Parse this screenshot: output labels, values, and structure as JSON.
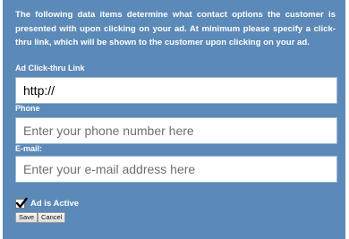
{
  "form": {
    "intro_text": "The following data items determine what contact options the customer is presented with upon clicking on your ad. At minimum please specify a click-thru link, which will be shown to the customer upon clicking on your ad.",
    "fields": {
      "click_thru": {
        "label": "Ad Click-thru Link",
        "value": "http://",
        "placeholder": ""
      },
      "phone": {
        "label": "Phone",
        "value": "",
        "placeholder": "Enter your phone number here"
      },
      "email": {
        "label": "E-mail:",
        "value": "",
        "placeholder": "Enter your e-mail address here"
      }
    },
    "active": {
      "label": "Ad is Active",
      "checked": true
    },
    "buttons": {
      "save": "Save",
      "cancel": "Cancel"
    }
  },
  "colors": {
    "panel_background": "#5b89b8",
    "text": "#ffffff"
  }
}
